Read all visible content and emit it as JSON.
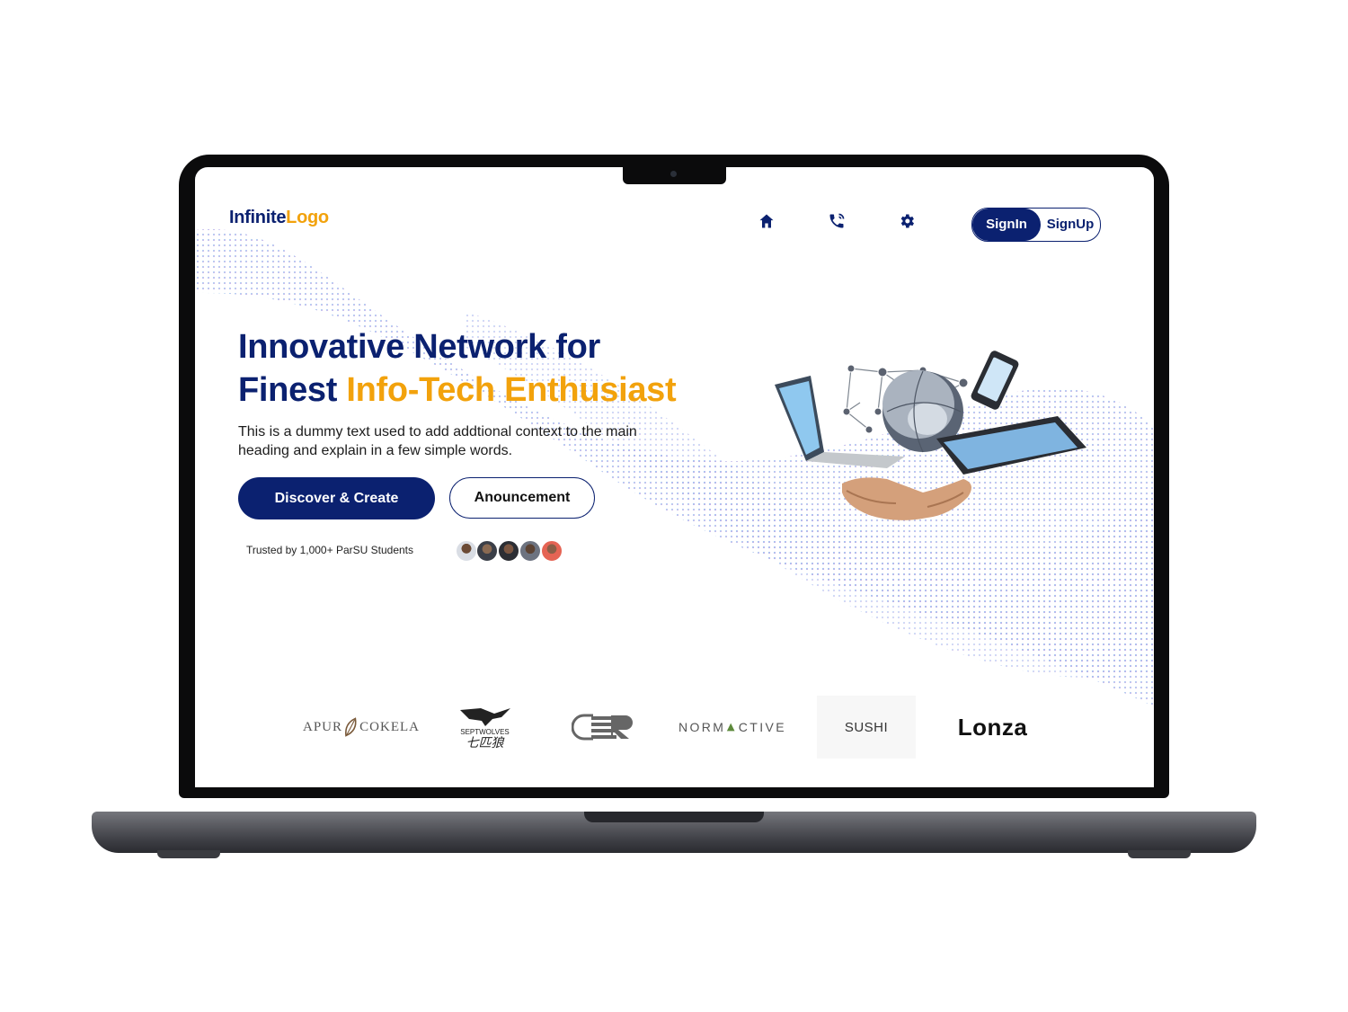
{
  "brand": {
    "logo_part1": "Infinite",
    "logo_part2": "Logo"
  },
  "nav": {
    "icons": [
      "home-icon",
      "phone-icon",
      "gear-icon"
    ],
    "signin_label": "SignIn",
    "signup_label": "SignUp"
  },
  "hero": {
    "heading_line1": "Innovative Network for",
    "heading_line2_prefix": "Finest ",
    "heading_line2_accent": "Info-Tech Enthusiast",
    "description": "This is a dummy text used to add addtional context to the main heading and explain in a few simple words.",
    "primary_cta": "Discover & Create",
    "secondary_cta": "Anouncement",
    "trusted_text": "Trusted by 1,000+  ParSU Students"
  },
  "partners": {
    "apurcokela": {
      "part1": "APUR",
      "part2": "COKELA"
    },
    "septwolves": {
      "en": "SEPTWOLVES",
      "cn": "七匹狼"
    },
    "normactive": {
      "part1": "NORM",
      "part2": "CTIVE"
    },
    "sushi": "SUSHI",
    "lonza": "Lonza"
  },
  "colors": {
    "primary": "#0b2170",
    "accent": "#f2a20c"
  }
}
